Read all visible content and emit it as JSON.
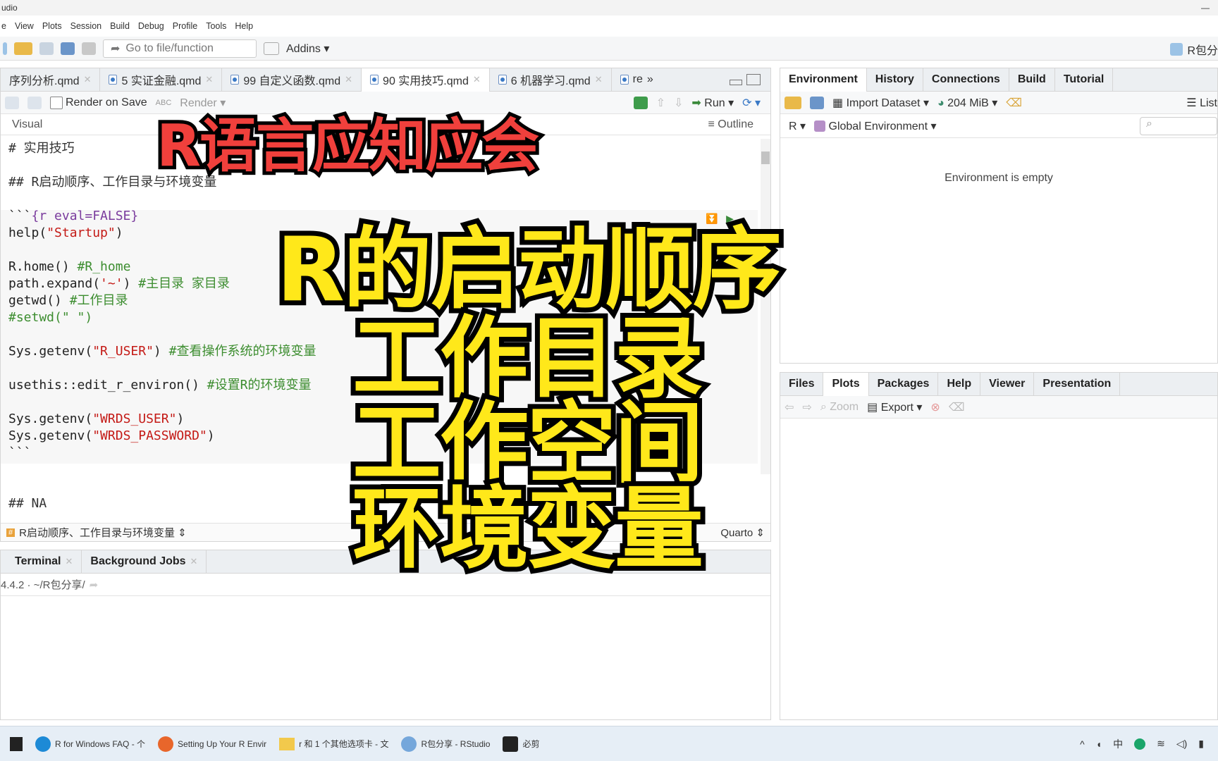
{
  "window": {
    "title": "udio"
  },
  "menu": [
    "e",
    "View",
    "Plots",
    "Session",
    "Build",
    "Debug",
    "Profile",
    "Tools",
    "Help"
  ],
  "toolbar": {
    "goto_placeholder": "Go to file/function",
    "addins": "Addins",
    "project": "R包分"
  },
  "editor": {
    "tabs": [
      {
        "label": "序列分析.qmd"
      },
      {
        "label": "5 实证金融.qmd"
      },
      {
        "label": "99 自定义函数.qmd"
      },
      {
        "label": "90 实用技巧.qmd",
        "active": true
      },
      {
        "label": "6 机器学习.qmd"
      },
      {
        "label": "re"
      }
    ],
    "render_on_save": "Render on Save",
    "render": "Render",
    "run": "Run",
    "visual": "Visual",
    "outline": "Outline",
    "lines": [
      [
        {
          "t": "# 实用技巧",
          "c": "md"
        }
      ],
      [],
      [
        {
          "t": "## R启动顺序、工作目录与环境变量",
          "c": "md"
        }
      ],
      [],
      [
        {
          "t": "```",
          "c": "pl"
        },
        {
          "t": "{r eval=FALSE}",
          "c": "kw"
        }
      ],
      [
        {
          "t": "help(",
          "c": "pl"
        },
        {
          "t": "\"Startup\"",
          "c": "str"
        },
        {
          "t": ")",
          "c": "pl"
        }
      ],
      [],
      [
        {
          "t": "R.home() ",
          "c": "pl"
        },
        {
          "t": "#R_home",
          "c": "cm"
        }
      ],
      [
        {
          "t": "path.expand(",
          "c": "pl"
        },
        {
          "t": "'~'",
          "c": "str"
        },
        {
          "t": ") ",
          "c": "pl"
        },
        {
          "t": "#主目录 家目录",
          "c": "cm"
        }
      ],
      [
        {
          "t": "getwd() ",
          "c": "pl"
        },
        {
          "t": "#工作目录",
          "c": "cm"
        }
      ],
      [
        {
          "t": "#setwd(\" \")",
          "c": "cm"
        }
      ],
      [],
      [
        {
          "t": "Sys.getenv(",
          "c": "pl"
        },
        {
          "t": "\"R_USER\"",
          "c": "str"
        },
        {
          "t": ") ",
          "c": "pl"
        },
        {
          "t": "#查看操作系统的环境变量",
          "c": "cm"
        }
      ],
      [],
      [
        {
          "t": "usethis::edit_r_environ() ",
          "c": "pl"
        },
        {
          "t": "#设置R的环境变量",
          "c": "cm"
        }
      ],
      [],
      [
        {
          "t": "Sys.getenv(",
          "c": "pl"
        },
        {
          "t": "\"WRDS_USER\"",
          "c": "str"
        },
        {
          "t": ")",
          "c": "pl"
        }
      ],
      [
        {
          "t": "Sys.getenv(",
          "c": "pl"
        },
        {
          "t": "\"WRDS_PASSWORD\"",
          "c": "str"
        },
        {
          "t": ")",
          "c": "pl"
        }
      ],
      [
        {
          "t": "```",
          "c": "pl"
        }
      ],
      [],
      [],
      [
        {
          "t": "## NA",
          "c": "md"
        }
      ]
    ],
    "status_section": "R启动顺序、工作目录与环境变量",
    "status_type": "Quarto"
  },
  "console": {
    "tabs": [
      "Terminal",
      "Background Jobs"
    ],
    "path": "4.4.2 · ~/R包分享/"
  },
  "environment": {
    "tabs": [
      "Environment",
      "History",
      "Connections",
      "Build",
      "Tutorial"
    ],
    "import": "Import Dataset",
    "memory": "204 MiB",
    "list": "List",
    "lang": "R",
    "scope": "Global Environment",
    "empty": "Environment is empty"
  },
  "files": {
    "tabs": [
      "Files",
      "Plots",
      "Packages",
      "Help",
      "Viewer",
      "Presentation"
    ],
    "zoom": "Zoom",
    "export": "Export"
  },
  "overlay": {
    "title": "R语言应知应会",
    "lines": [
      "R的启动顺序",
      "工作目录",
      "工作空间",
      "环境变量"
    ]
  },
  "taskbar": {
    "items": [
      "R for Windows FAQ - 个",
      "Setting Up Your R Envir",
      "r 和 1 个其他选项卡 - 文",
      "R包分享 - RStudio",
      "必剪"
    ],
    "ime": "中"
  }
}
